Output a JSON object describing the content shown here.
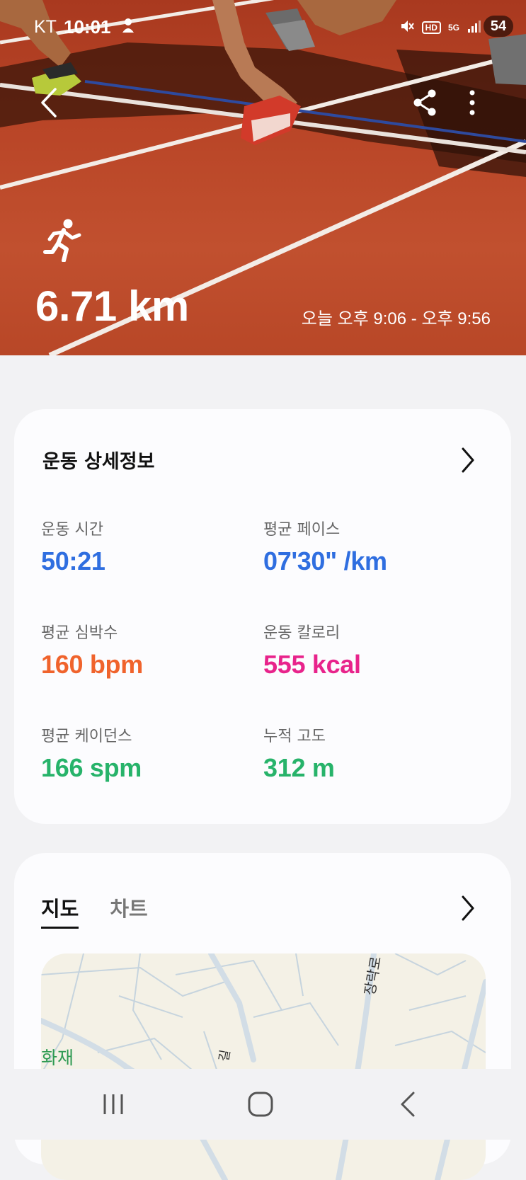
{
  "status_bar": {
    "carrier": "KT",
    "time": "10:01",
    "hd": "HD",
    "network": "5G",
    "battery": "54"
  },
  "workout": {
    "distance": "6.71 km",
    "time_range": "오늘 오후 9:06 - 오후 9:56",
    "activity_icon": "running-icon"
  },
  "details": {
    "title": "운동 상세정보",
    "stats": [
      {
        "label": "운동 시간",
        "value": "50:21",
        "color": "#2f6ee0"
      },
      {
        "label": "평균 페이스",
        "value": "07'30\" /km",
        "color": "#2f6ee0"
      },
      {
        "label": "평균 심박수",
        "value": "160 bpm",
        "color": "#f0632c"
      },
      {
        "label": "운동 칼로리",
        "value": "555 kcal",
        "color": "#e8238b"
      },
      {
        "label": "평균 케이던스",
        "value": "166 spm",
        "color": "#27b36a"
      },
      {
        "label": "누적 고도",
        "value": "312 m",
        "color": "#27b36a"
      }
    ]
  },
  "map_section": {
    "tabs": [
      {
        "label": "지도",
        "active": true
      },
      {
        "label": "차트",
        "active": false
      }
    ],
    "map_labels": {
      "road": "장락로",
      "place": "화재",
      "road_partial": "길"
    }
  },
  "icons": {
    "back": "back-arrow-icon",
    "share": "share-icon",
    "more": "more-vertical-icon",
    "chevron": "chevron-right-icon",
    "recents": "recents-icon",
    "home": "home-icon",
    "nav_back": "nav-back-icon"
  }
}
